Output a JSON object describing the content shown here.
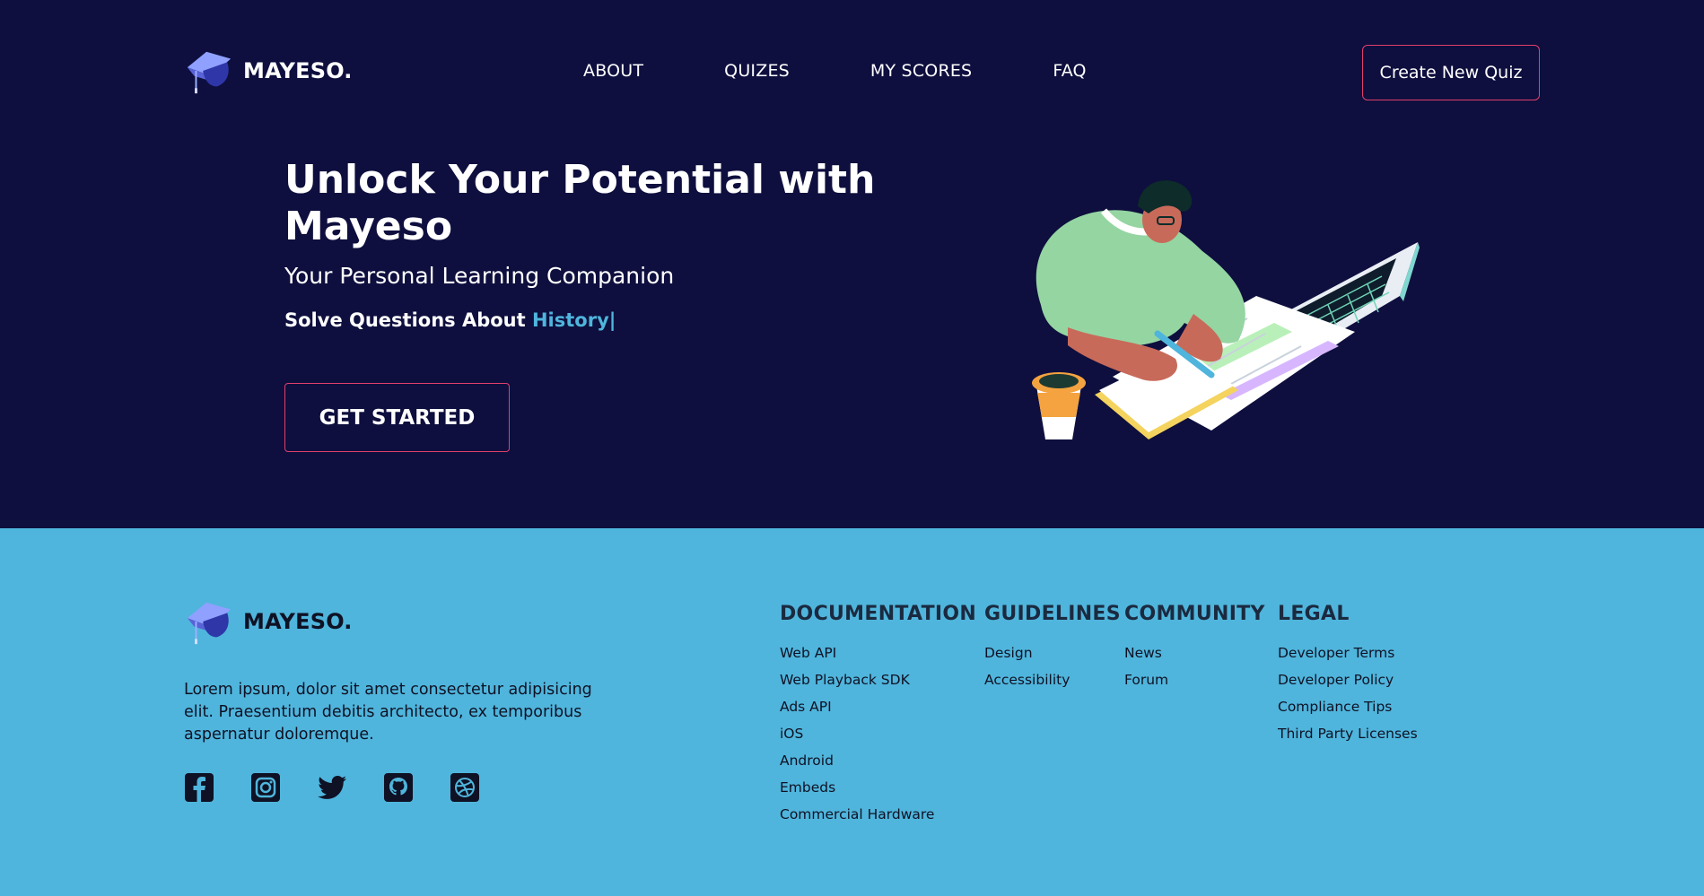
{
  "brand": {
    "name": "MAYESO.",
    "logo_icon": "graduation-cap-icon"
  },
  "nav": {
    "items": [
      {
        "label": "ABOUT"
      },
      {
        "label": "QUIZES"
      },
      {
        "label": "MY SCORES"
      },
      {
        "label": "FAQ"
      }
    ],
    "cta_label": "Create New Quiz"
  },
  "hero": {
    "title": "Unlock Your Potential with Mayeso",
    "subtitle": "Your Personal Learning Companion",
    "solve_prefix": "Solve Questions About ",
    "solve_topic": "History|",
    "cta_label": "GET STARTED",
    "illustration": "student-studying-illustration"
  },
  "footer": {
    "description": "Lorem ipsum, dolor sit amet consectetur adipisicing elit. Praesentium debitis architecto, ex temporibus aspernatur doloremque.",
    "socials": [
      "facebook-icon",
      "instagram-icon",
      "twitter-icon",
      "github-icon",
      "dribbble-icon"
    ],
    "columns": [
      {
        "title": "DOCUMENTATION",
        "links": [
          "Web API",
          "Web Playback SDK",
          "Ads API",
          "iOS",
          "Android",
          "Embeds",
          "Commercial Hardware"
        ]
      },
      {
        "title": "GUIDELINES",
        "links": [
          "Design",
          "Accessibility"
        ]
      },
      {
        "title": "COMMUNITY",
        "links": [
          "News",
          "Forum"
        ]
      },
      {
        "title": "LEGAL",
        "links": [
          "Developer Terms",
          "Developer Policy",
          "Compliance Tips",
          "Third Party Licenses"
        ]
      }
    ]
  },
  "colors": {
    "hero_bg": "#0e0f3e",
    "footer_bg": "#4fb5dc",
    "accent_border": "#e0406a",
    "topic_highlight": "#4fb5dc"
  }
}
